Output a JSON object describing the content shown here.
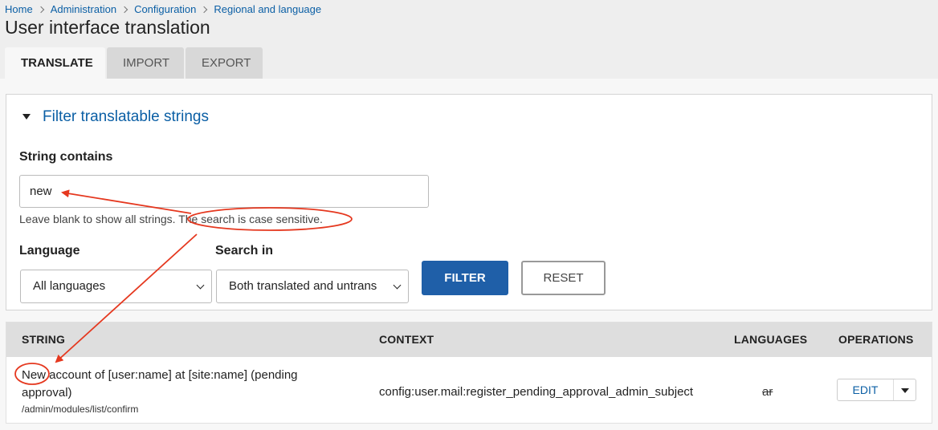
{
  "breadcrumb": [
    "Home",
    "Administration",
    "Configuration",
    "Regional and language"
  ],
  "page_title": "User interface translation",
  "tabs": [
    {
      "label": "TRANSLATE",
      "active": true
    },
    {
      "label": "IMPORT",
      "active": false
    },
    {
      "label": "EXPORT",
      "active": false
    }
  ],
  "filter": {
    "summary": "Filter translatable strings",
    "string_contains_label": "String contains",
    "string_contains_value": "new",
    "description_1": "Leave blank to show all strings.",
    "description_2": "The search is case sensitive.",
    "language_label": "Language",
    "language_value": "All languages",
    "search_in_label": "Search in",
    "search_in_value": "Both translated and untrans",
    "filter_button": "FILTER",
    "reset_button": "RESET"
  },
  "table": {
    "headers": [
      "STRING",
      "CONTEXT",
      "LANGUAGES",
      "OPERATIONS"
    ],
    "rows": [
      {
        "string_highlight": "New",
        "string_rest": " account of [user:name] at [site:name] (pending approval)",
        "path": "/admin/modules/list/confirm",
        "context": "config:user.mail:register_pending_approval_admin_subject",
        "languages": "ar",
        "operation": "EDIT"
      }
    ]
  },
  "colors": {
    "link": "#0b5fa5",
    "primary_button": "#1f5fa8",
    "annotation": "#e5381f"
  }
}
